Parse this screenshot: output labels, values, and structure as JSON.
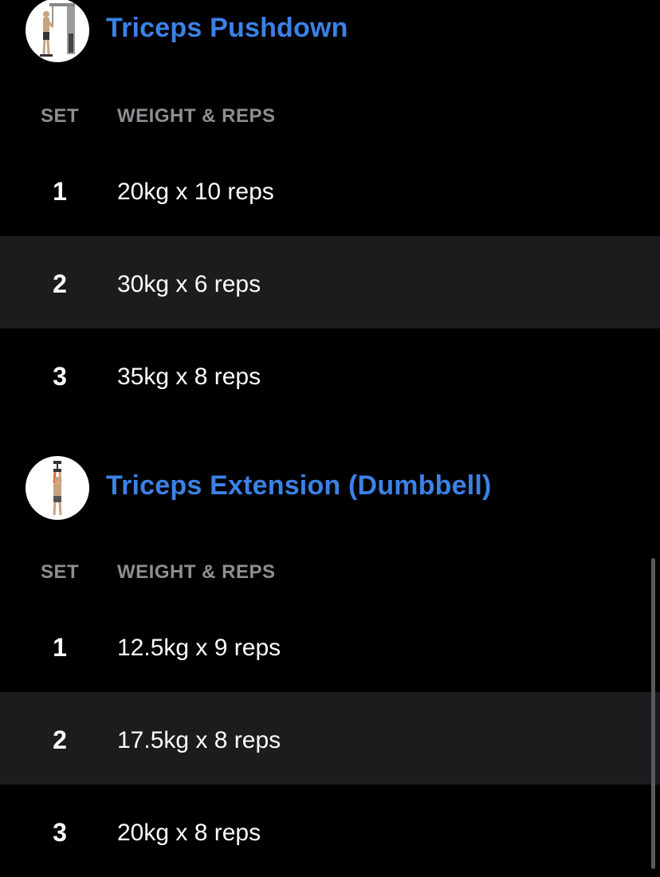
{
  "column_headers": {
    "set": "SET",
    "weight_reps": "WEIGHT & REPS"
  },
  "exercises": [
    {
      "name": "Triceps Pushdown",
      "thumbnail_icon": "cable-pushdown-illustration",
      "sets": [
        {
          "number": "1",
          "value": "20kg x 10 reps"
        },
        {
          "number": "2",
          "value": "30kg x 6 reps"
        },
        {
          "number": "3",
          "value": "35kg x 8 reps"
        }
      ]
    },
    {
      "name": "Triceps Extension (Dumbbell)",
      "thumbnail_icon": "dumbbell-overhead-extension-illustration",
      "sets": [
        {
          "number": "1",
          "value": "12.5kg x 9 reps"
        },
        {
          "number": "2",
          "value": "17.5kg x 8 reps"
        },
        {
          "number": "3",
          "value": "20kg x 8 reps"
        }
      ]
    }
  ],
  "colors": {
    "accent": "#3b82e6",
    "background": "#000000",
    "alt_row": "#1c1c1e",
    "muted_text": "#8e8e93"
  }
}
